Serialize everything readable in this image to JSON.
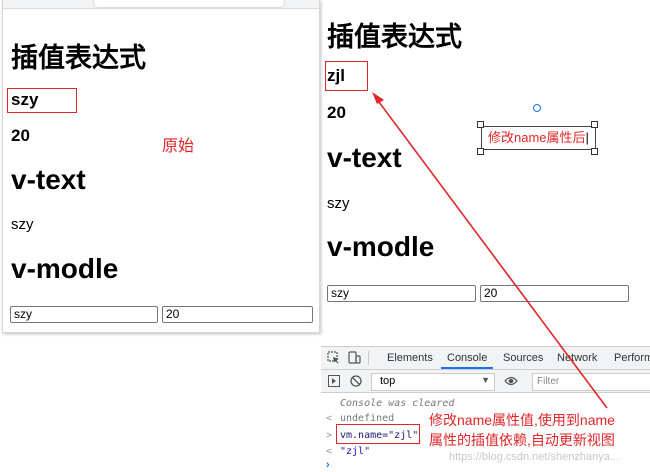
{
  "left": {
    "title": "插值表达式",
    "name_value": "szy",
    "age_value": "20",
    "vtext_heading": "v-text",
    "vtext_value": "szy",
    "vmodle_heading": "v-modle",
    "input_name": "szy",
    "input_age": "20",
    "annotation": "原始"
  },
  "right": {
    "title": "插值表达式",
    "name_value": "zjl",
    "age_value": "20",
    "vtext_heading": "v-text",
    "vtext_value": "szy",
    "vmodle_heading": "v-modle",
    "input_name": "szy",
    "input_age": "20",
    "annotation_box": "修改name属性后"
  },
  "devtools": {
    "tabs": [
      "Elements",
      "Console",
      "Sources",
      "Network",
      "Perform"
    ],
    "active_tab": "Console",
    "context": "top",
    "filter_placeholder": "Filter",
    "lines": {
      "cleared": "Console was cleared",
      "undefined": "undefined",
      "command": "vm.name=\"zjl\"",
      "result": "\"zjl\""
    },
    "annotation_line1": "修改name属性值,使用到name",
    "annotation_line2": "属性的插值依赖,自动更新视图",
    "watermark": "https://blog.csdn.net/shenzhanya..."
  },
  "colors": {
    "annotation_red": "#e0262a",
    "devtools_active": "#1a73e8",
    "panel_border": "#d6d6d6"
  }
}
